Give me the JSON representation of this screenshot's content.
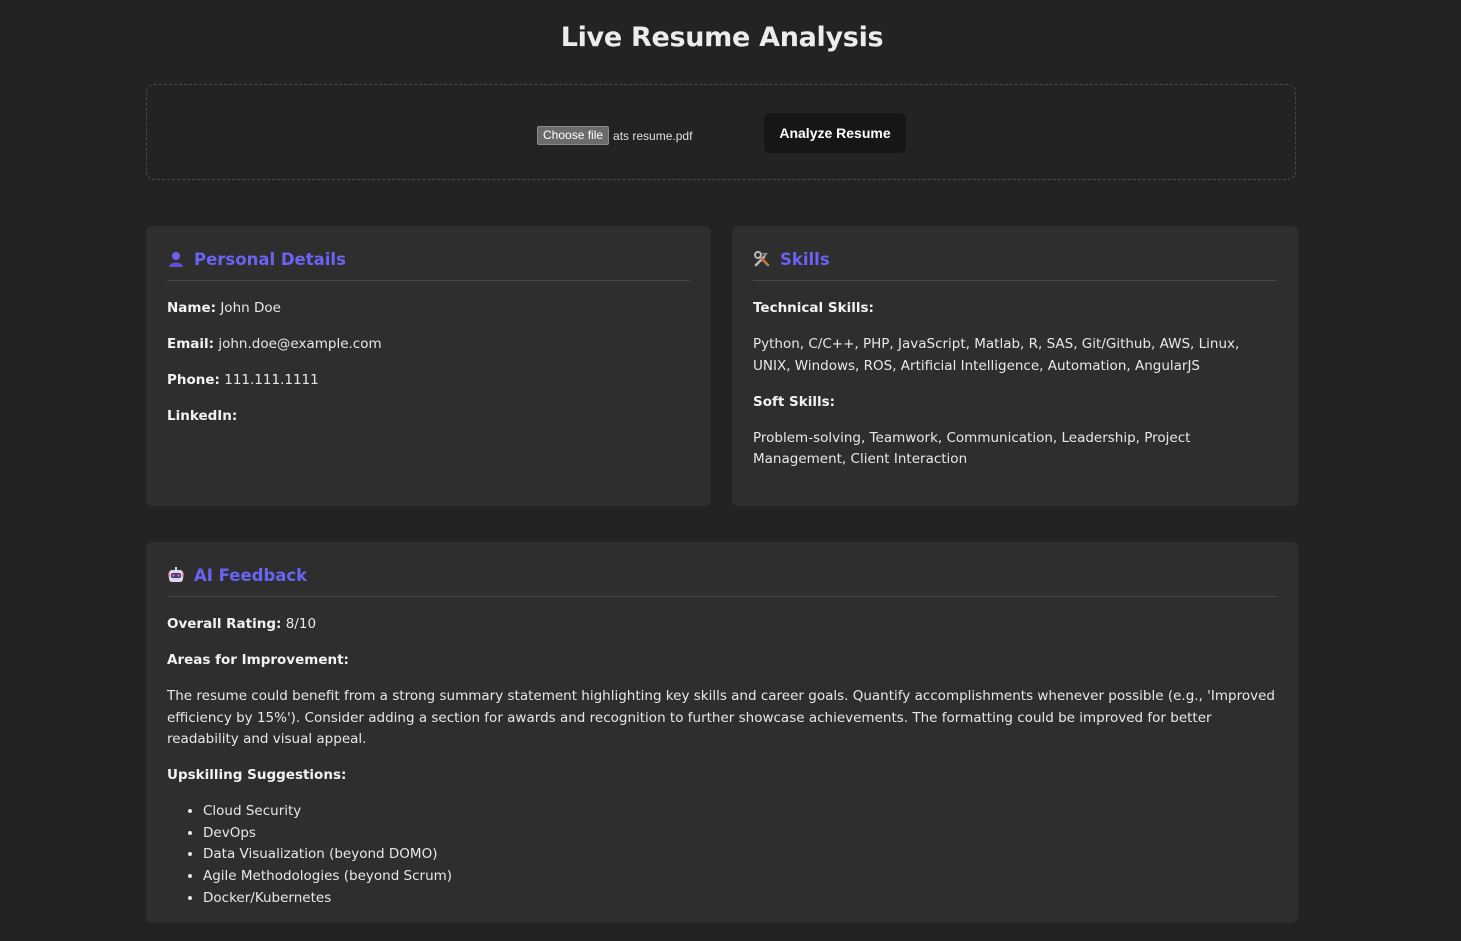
{
  "page": {
    "title": "Live Resume Analysis"
  },
  "upload": {
    "choose_label": "Choose file",
    "file_name": "ats resume.pdf",
    "analyze_label": "Analyze Resume"
  },
  "personal": {
    "title": "Personal Details",
    "icon": "person-icon",
    "name_label": "Name:",
    "name_value": "John Doe",
    "email_label": "Email:",
    "email_value": "john.doe@example.com",
    "phone_label": "Phone:",
    "phone_value": "111.111.1111",
    "linkedin_label": "LinkedIn:",
    "linkedin_value": ""
  },
  "skills": {
    "title": "Skills",
    "icon": "tools-icon",
    "technical_label": "Technical Skills:",
    "technical_value": "Python, C/C++, PHP, JavaScript, Matlab, R, SAS, Git/Github, AWS, Linux, UNIX, Windows, ROS, Artificial Intelligence, Automation, AngularJS",
    "soft_label": "Soft Skills:",
    "soft_value": "Problem-solving, Teamwork, Communication, Leadership, Project Management, Client Interaction"
  },
  "feedback": {
    "title": "AI Feedback",
    "icon": "robot-icon",
    "rating_label": "Overall Rating:",
    "rating_value": "8/10",
    "improvement_label": "Areas for Improvement:",
    "improvement_text": "The resume could benefit from a strong summary statement highlighting key skills and career goals. Quantify accomplishments whenever possible (e.g., 'Improved efficiency by 15%'). Consider adding a section for awards and recognition to further showcase achievements. The formatting could be improved for better readability and visual appeal.",
    "upskilling_label": "Upskilling Suggestions:",
    "upskilling_items": [
      "Cloud Security",
      "DevOps",
      "Data Visualization (beyond DOMO)",
      "Agile Methodologies (beyond Scrum)",
      "Docker/Kubernetes"
    ]
  },
  "colors": {
    "background": "#232323",
    "card": "#2e2e2e",
    "accent": "#6b63f2",
    "button": "#161616"
  }
}
